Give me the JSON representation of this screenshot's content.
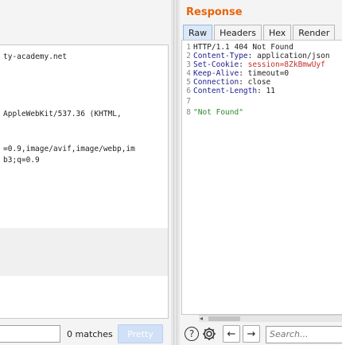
{
  "request": {
    "lines": [
      "ty-academy.net",
      "AppleWebKit/537.36 (KHTML,",
      "=0.9,image/avif,image/webp,im",
      "b3;q=0.9"
    ],
    "matches_label": "0 matches",
    "pretty_label": "Pretty"
  },
  "response": {
    "title": "Response",
    "tabs": [
      "Raw",
      "Headers",
      "Hex",
      "Render"
    ],
    "active_tab": "Raw",
    "lines": [
      {
        "n": "1",
        "key": "HTTP/1.1 404 Not Found",
        "sep": "",
        "val": ""
      },
      {
        "n": "2",
        "key": "Content-Type",
        "sep": ": ",
        "val": "application/json"
      },
      {
        "n": "3",
        "key": "Set-Cookie",
        "sep": ": ",
        "val": "session=8ZkBmwUyf"
      },
      {
        "n": "4",
        "key": "Keep-Alive",
        "sep": ": ",
        "val": "timeout=0"
      },
      {
        "n": "5",
        "key": "Connection",
        "sep": ": ",
        "val": "close"
      },
      {
        "n": "6",
        "key": "Content-Length",
        "sep": ": ",
        "val": "11"
      },
      {
        "n": "7",
        "key": "",
        "sep": "",
        "val": ""
      },
      {
        "n": "8",
        "key": "",
        "sep": "",
        "val": "\"Not Found\""
      }
    ],
    "search_placeholder": "Search...",
    "help_glyph": "?",
    "back_glyph": "←",
    "forward_glyph": "→"
  },
  "colors": {
    "accent": "#e8630a",
    "header_key": "#1c1c8c",
    "cookie_value": "#c4302b",
    "string_value": "#2e8b2e"
  }
}
